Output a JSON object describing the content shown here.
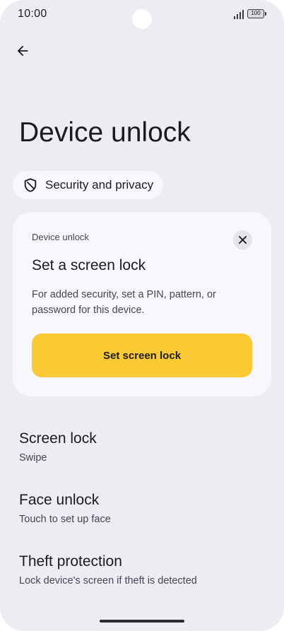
{
  "status_bar": {
    "time": "10:00",
    "battery_level": "100",
    "icons": [
      "signal-icon",
      "battery-icon"
    ]
  },
  "header": {
    "back_icon": "arrow-back-icon",
    "title": "Device unlock"
  },
  "breadcrumb": {
    "icon": "shield-icon",
    "label": "Security and privacy"
  },
  "card": {
    "overline": "Device unlock",
    "title": "Set a screen lock",
    "body": "For added security, set a PIN, pattern, or password for this device.",
    "action_label": "Set screen lock",
    "close_icon": "close-icon"
  },
  "settings_items": [
    {
      "title": "Screen lock",
      "summary": "Swipe"
    },
    {
      "title": "Face unlock",
      "summary": "Touch to set up face"
    },
    {
      "title": "Theft protection",
      "summary": "Lock device's screen if theft is detected"
    }
  ],
  "colors": {
    "background": "#ececf3",
    "card": "#f7f7fc",
    "accent": "#fbc934",
    "text_primary": "#1b1b1f",
    "text_secondary": "#45464f"
  }
}
